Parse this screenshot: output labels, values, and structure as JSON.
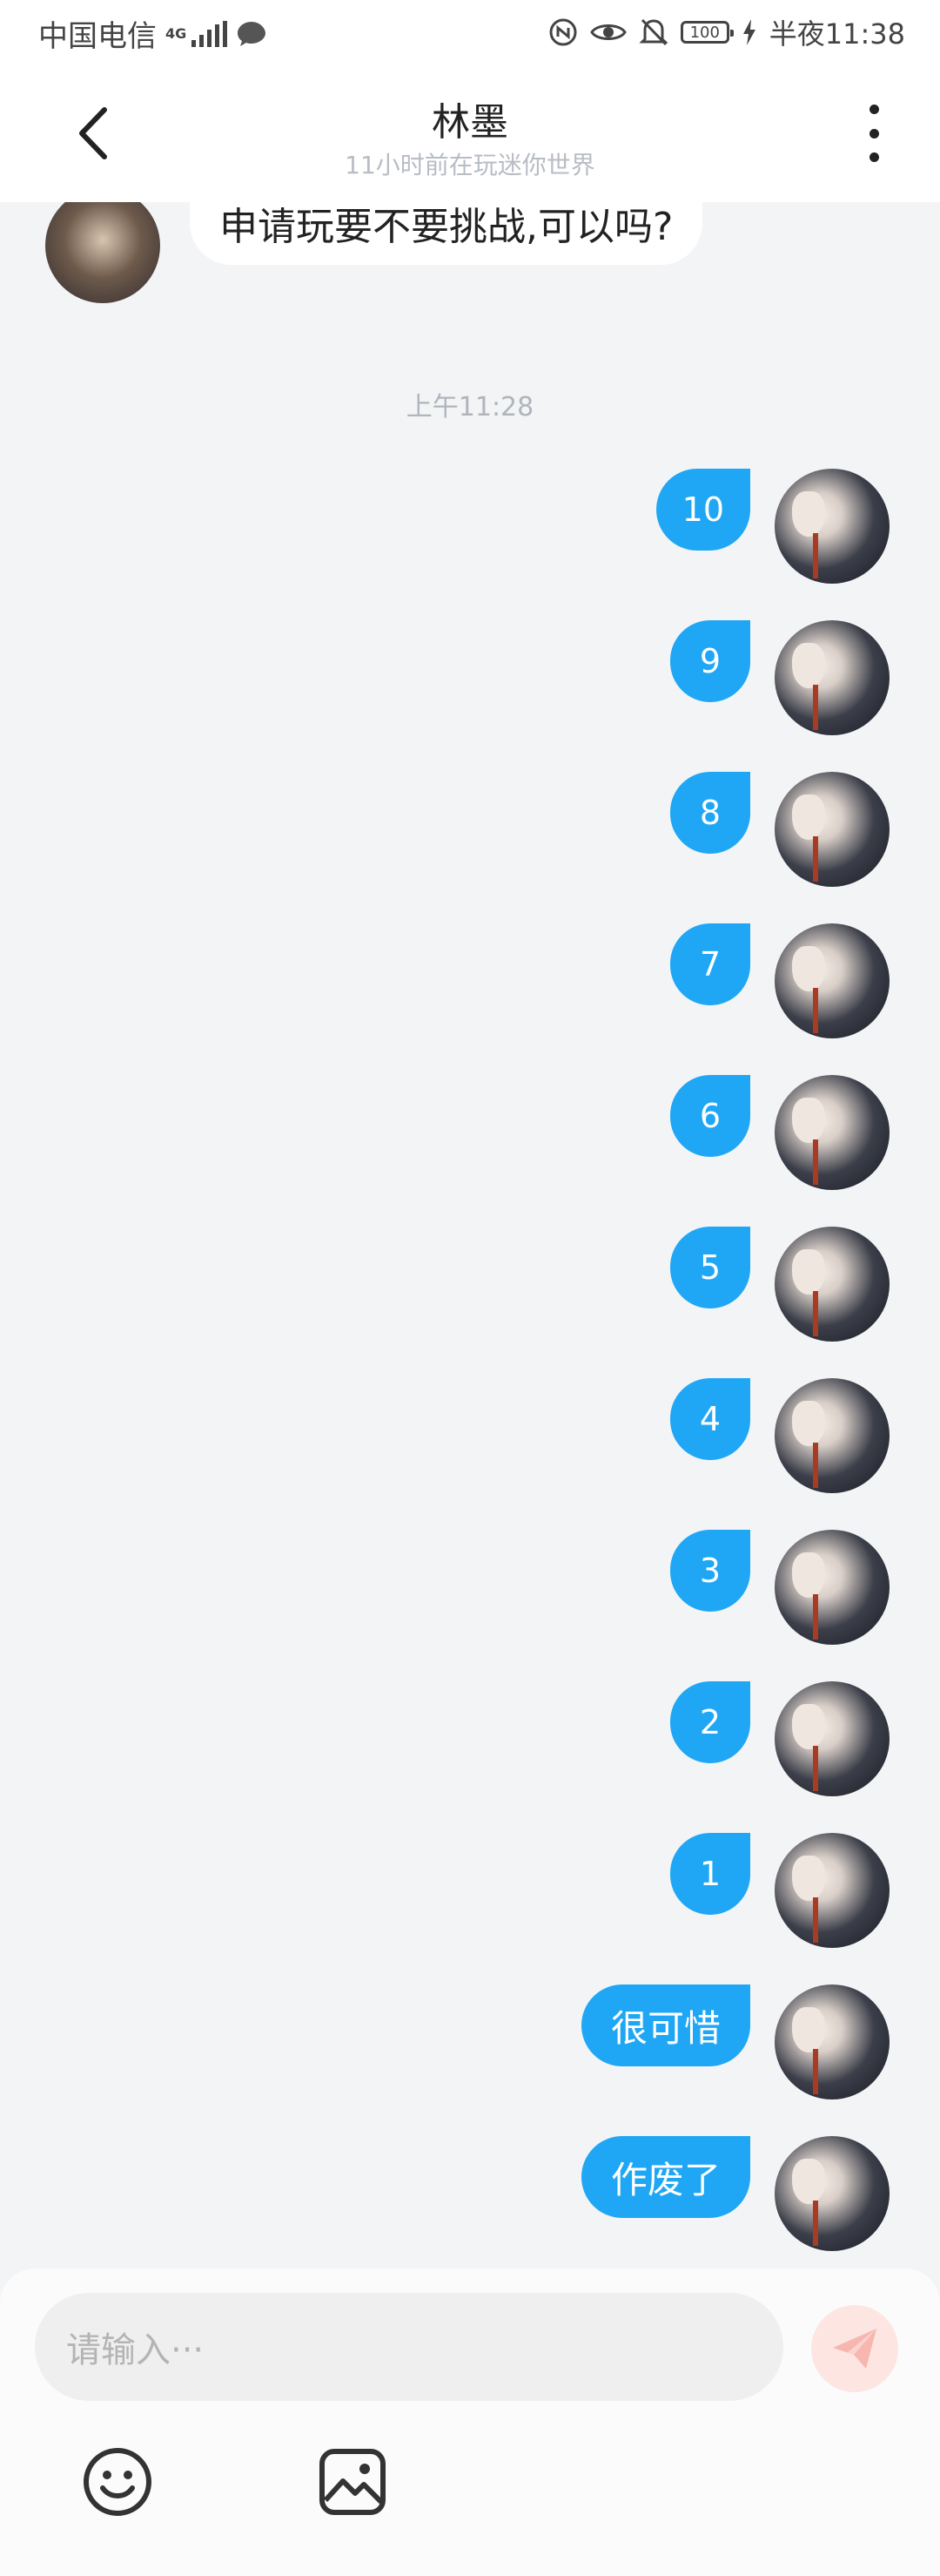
{
  "status_bar": {
    "carrier": "中国电信",
    "network": "4G",
    "battery": "100",
    "time": "半夜11:38"
  },
  "header": {
    "title": "林墨",
    "subtitle": "11小时前在玩迷你世界"
  },
  "chat": {
    "incoming": {
      "text": "申请玩要不要挑战,可以吗?"
    },
    "timestamp": "上午11:28",
    "outgoing": [
      {
        "text": "10"
      },
      {
        "text": "9"
      },
      {
        "text": "8"
      },
      {
        "text": "7"
      },
      {
        "text": "6"
      },
      {
        "text": "5"
      },
      {
        "text": "4"
      },
      {
        "text": "3"
      },
      {
        "text": "2"
      },
      {
        "text": "1"
      },
      {
        "text": "很可惜"
      },
      {
        "text": "作废了"
      }
    ]
  },
  "composer": {
    "placeholder": "请输入···"
  },
  "colors": {
    "accent": "#1fa7f5",
    "send_disabled": "#fde5e2"
  },
  "icons": [
    "back-arrow-icon",
    "more-vertical-icon",
    "send-icon",
    "emoji-icon",
    "image-icon",
    "eye-icon",
    "mute-icon",
    "signal-icon",
    "chat-bubble-icon",
    "battery-icon",
    "charging-icon",
    "nfc-icon"
  ]
}
